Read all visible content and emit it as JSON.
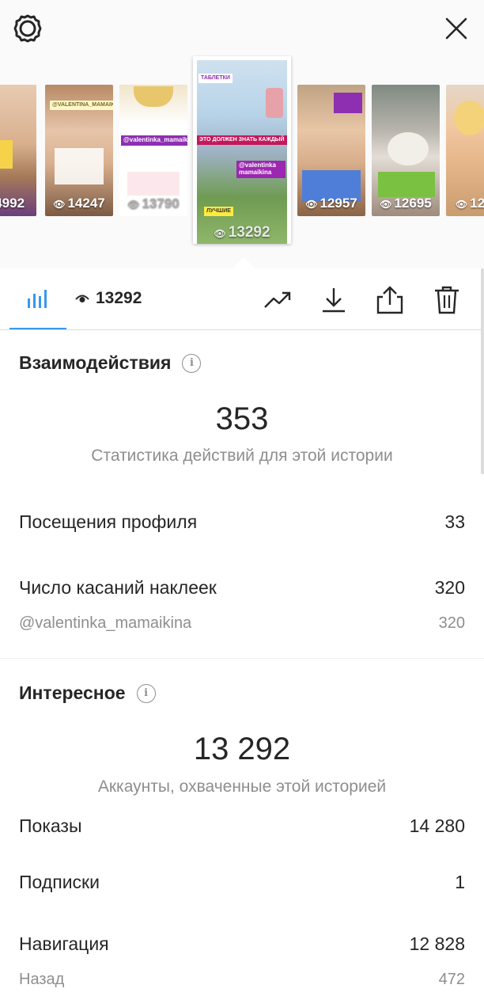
{
  "top": {
    "settings_icon": "gear-icon",
    "close_icon": "close-icon"
  },
  "thumbnails": [
    {
      "views": "4992"
    },
    {
      "views": "14247",
      "tag": "@VALENTINA_MAMAIKINA"
    },
    {
      "views": "13790",
      "tag": "@valentinka_mamaikina"
    },
    {
      "views": "13292",
      "selected": true,
      "tags": [
        "ТАБЛЕТКИ",
        "ЭТО ДОЛЖЕН ЗНАТЬ КАЖДЫЙ",
        "@valentinka mamaikina",
        "ЛУЧШИЕ"
      ]
    },
    {
      "views": "12957"
    },
    {
      "views": "12695"
    },
    {
      "views": "12"
    }
  ],
  "tabs": {
    "views_count": "13292",
    "chart_icon": "bar-chart-icon",
    "trend_icon": "trending-up-icon",
    "download_icon": "download-icon",
    "share_icon": "share-icon",
    "delete_icon": "trash-icon"
  },
  "interactions": {
    "title": "Взаимодействия",
    "total": "353",
    "caption": "Статистика действий для этой истории",
    "rows": [
      {
        "label": "Посещения профиля",
        "value": "33"
      },
      {
        "label": "Число касаний наклеек",
        "value": "320"
      }
    ],
    "sub_rows": [
      {
        "label": "@valentinka_mamaikina",
        "value": "320"
      }
    ]
  },
  "discovery": {
    "title": "Интересное",
    "total": "13 292",
    "caption": "Аккаунты, охваченные этой историей",
    "rows": [
      {
        "label": "Показы",
        "value": "14 280"
      },
      {
        "label": "Подписки",
        "value": "1"
      },
      {
        "label": "Навигация",
        "value": "12 828"
      }
    ],
    "sub_rows": [
      {
        "label": "Назад",
        "value": "472"
      }
    ]
  },
  "colors": {
    "accent": "#3897f0",
    "text": "#262626",
    "muted": "#8e8e8e"
  }
}
